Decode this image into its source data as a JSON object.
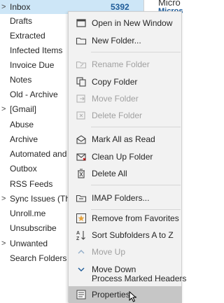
{
  "folders": {
    "inbox": {
      "label": "Inbox",
      "count": "5392"
    },
    "items": [
      {
        "label": "Drafts"
      },
      {
        "label": "Extracted"
      },
      {
        "label": "Infected Items"
      },
      {
        "label": "Invoice Due"
      },
      {
        "label": "Notes"
      },
      {
        "label": "Old - Archive"
      },
      {
        "label": "[Gmail]"
      },
      {
        "label": "Abuse"
      },
      {
        "label": "Archive"
      },
      {
        "label": "Automated and b"
      },
      {
        "label": "Outbox"
      },
      {
        "label": "RSS Feeds"
      },
      {
        "label": "Sync Issues (This"
      },
      {
        "label": "Unroll.me"
      },
      {
        "label": "Unsubscribe"
      },
      {
        "label": "Unwanted"
      },
      {
        "label": "Search Folders"
      }
    ]
  },
  "reading_pane": {
    "line1": "Micro",
    "line2": "Microso"
  },
  "context_menu": {
    "open_new_window": "Open in New Window",
    "new_folder": "New Folder...",
    "rename_folder": "Rename Folder",
    "copy_folder": "Copy Folder",
    "move_folder": "Move Folder",
    "delete_folder": "Delete Folder",
    "mark_all_read": "Mark All as Read",
    "clean_up_folder": "Clean Up Folder",
    "delete_all": "Delete All",
    "imap_folders": "IMAP Folders...",
    "remove_favorites": "Remove from Favorites",
    "sort_subfolders": "Sort Subfolders A to Z",
    "move_up": "Move Up",
    "move_down": "Move Down",
    "process_marked_headers": "Process Marked Headers",
    "properties": "Properties..."
  },
  "colors": {
    "selected_bg": "#cde6f7",
    "accent": "#1f5c99",
    "menu_bg": "#f2f2f2",
    "hover_bg": "#c6c6c6",
    "favorite_star": "#e6a23c"
  }
}
